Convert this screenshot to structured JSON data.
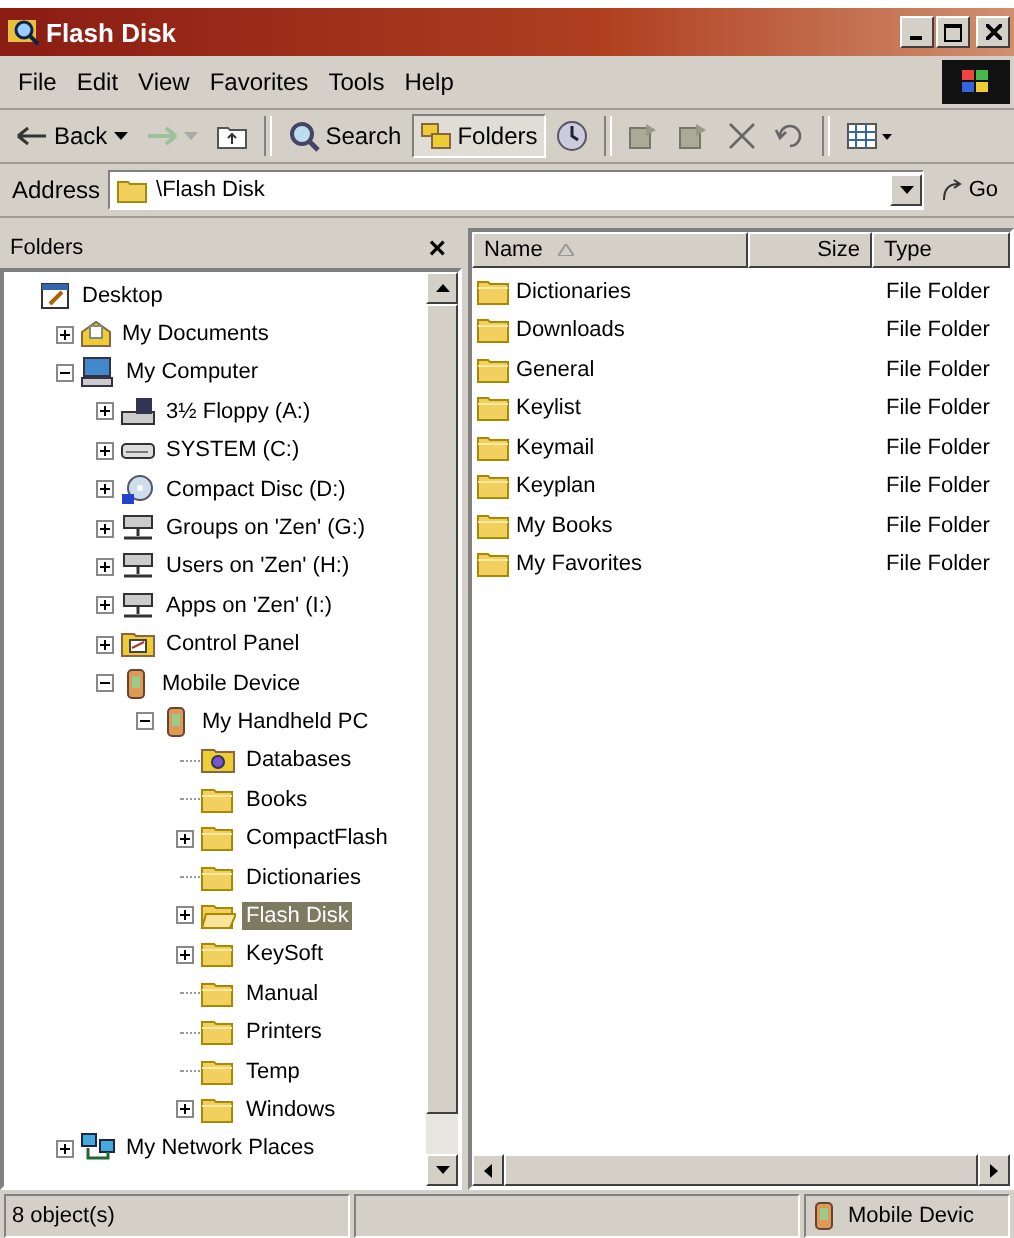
{
  "window": {
    "title": "Flash Disk"
  },
  "menu": [
    "File",
    "Edit",
    "View",
    "Favorites",
    "Tools",
    "Help"
  ],
  "toolbar": [
    {
      "kind": "back",
      "label": "Back",
      "disabled": false
    },
    {
      "kind": "forward",
      "disabled": true
    },
    {
      "kind": "up",
      "disabled": false
    },
    {
      "kind": "search",
      "label": "Search",
      "disabled": false,
      "pressed": false
    },
    {
      "kind": "folders",
      "label": "Folders",
      "disabled": false,
      "pressed": true
    },
    {
      "kind": "history",
      "disabled": false
    },
    {
      "kind": "moveto",
      "disabled": false
    },
    {
      "kind": "copyto",
      "disabled": false
    },
    {
      "kind": "delete",
      "disabled": false
    },
    {
      "kind": "undo",
      "disabled": false
    },
    {
      "kind": "views",
      "disabled": false
    }
  ],
  "address": {
    "label": "Address",
    "value": "\\Flash Disk",
    "go": "Go"
  },
  "folders_pane": {
    "title": "Folders",
    "close": "×"
  },
  "tree": [
    {
      "label": "Desktop",
      "kind": "desktop",
      "selected": false,
      "children": [
        {
          "label": "My Documents",
          "kind": "documents",
          "selected": false,
          "expanded": false
        },
        {
          "label": "My Computer",
          "kind": "computer",
          "selected": false,
          "expanded": true,
          "children": [
            {
              "label": "3½ Floppy (A:)",
              "kind": "floppy",
              "selected": false,
              "expanded": false
            },
            {
              "label": "SYSTEM (C:)",
              "kind": "drive",
              "selected": false,
              "expanded": false
            },
            {
              "label": "Compact Disc (D:)",
              "kind": "cd",
              "selected": false,
              "expanded": false
            },
            {
              "label": "Groups on 'Zen' (G:)",
              "kind": "netdrive",
              "selected": false,
              "expanded": false
            },
            {
              "label": "Users on 'Zen' (H:)",
              "kind": "netdrive",
              "selected": false,
              "expanded": false
            },
            {
              "label": "Apps on 'Zen' (I:)",
              "kind": "netdrive",
              "selected": false,
              "expanded": false
            },
            {
              "label": "Control Panel",
              "kind": "control",
              "selected": false,
              "expanded": false
            },
            {
              "label": "Mobile Device",
              "kind": "device",
              "selected": false,
              "expanded": true,
              "children": [
                {
                  "label": "My Handheld PC",
                  "kind": "device",
                  "selected": false,
                  "expanded": true,
                  "children": [
                    {
                      "label": "Databases",
                      "kind": "database",
                      "selected": false
                    },
                    {
                      "label": "Books",
                      "kind": "folder",
                      "selected": false
                    },
                    {
                      "label": "CompactFlash",
                      "kind": "folder",
                      "selected": false,
                      "expanded": false
                    },
                    {
                      "label": "Dictionaries",
                      "kind": "folder",
                      "selected": false
                    },
                    {
                      "label": "Flash Disk",
                      "kind": "folder",
                      "selected": true,
                      "expanded": false
                    },
                    {
                      "label": "KeySoft",
                      "kind": "folder",
                      "selected": false,
                      "expanded": false
                    },
                    {
                      "label": "Manual",
                      "kind": "folder",
                      "selected": false
                    },
                    {
                      "label": "Printers",
                      "kind": "folder",
                      "selected": false
                    },
                    {
                      "label": "Temp",
                      "kind": "folder",
                      "selected": false
                    },
                    {
                      "label": "Windows",
                      "kind": "folder",
                      "selected": false,
                      "expanded": false
                    }
                  ]
                }
              ]
            }
          ]
        },
        {
          "label": "My Network Places",
          "kind": "network",
          "selected": false,
          "expanded": false
        }
      ]
    }
  ],
  "list": {
    "columns": [
      "Name",
      "Size",
      "Type"
    ],
    "rows": [
      {
        "name": "Dictionaries",
        "type": "File Folder"
      },
      {
        "name": "Downloads",
        "type": "File Folder"
      },
      {
        "name": "General",
        "type": "File Folder"
      },
      {
        "name": "Keylist",
        "type": "File Folder"
      },
      {
        "name": "Keymail",
        "type": "File Folder"
      },
      {
        "name": "Keyplan",
        "type": "File Folder"
      },
      {
        "name": "My Books",
        "type": "File Folder"
      },
      {
        "name": "My Favorites",
        "type": "File Folder"
      }
    ]
  },
  "status_bar": {
    "objects": "8 object(s)",
    "zone": "Mobile Devic"
  }
}
